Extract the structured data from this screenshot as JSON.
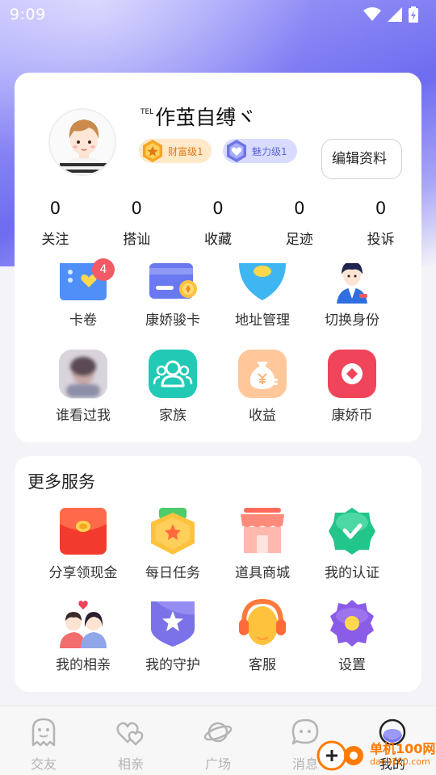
{
  "status_bar": {
    "time": "9:09"
  },
  "profile": {
    "tel_mark": "TEL",
    "nickname": "作茧自缚ヾ",
    "wealth_badge": "财富级1",
    "charm_badge": "魅力级1",
    "edit_button": "编辑资料"
  },
  "stats": [
    {
      "value": "0",
      "label": "关注"
    },
    {
      "value": "0",
      "label": "搭讪"
    },
    {
      "value": "0",
      "label": "收藏"
    },
    {
      "value": "0",
      "label": "足迹"
    },
    {
      "value": "0",
      "label": "投诉"
    }
  ],
  "top_grid": [
    {
      "label": "卡卷",
      "badge": "4",
      "icon": "ticket-icon"
    },
    {
      "label": "康娇骏卡",
      "icon": "vip-card-icon"
    },
    {
      "label": "地址管理",
      "icon": "address-icon"
    },
    {
      "label": "切换身份",
      "icon": "identity-icon"
    },
    {
      "label": "谁看过我",
      "icon": "visitors-icon"
    },
    {
      "label": "家族",
      "icon": "family-icon"
    },
    {
      "label": "收益",
      "icon": "income-bag-icon"
    },
    {
      "label": "康娇币",
      "icon": "coin-icon"
    }
  ],
  "more_services": {
    "title": "更多服务",
    "items": [
      {
        "label": "分享领现金",
        "icon": "red-envelope-icon"
      },
      {
        "label": "每日任务",
        "icon": "daily-task-icon"
      },
      {
        "label": "道具商城",
        "icon": "shop-icon"
      },
      {
        "label": "我的认证",
        "icon": "verified-icon"
      },
      {
        "label": "我的相亲",
        "icon": "couple-icon"
      },
      {
        "label": "我的守护",
        "icon": "guard-shield-icon"
      },
      {
        "label": "客服",
        "icon": "headset-icon"
      },
      {
        "label": "设置",
        "icon": "settings-gear-icon"
      }
    ]
  },
  "tabbar": [
    {
      "label": "交友",
      "icon": "ghost-icon"
    },
    {
      "label": "相亲",
      "icon": "hearts-icon"
    },
    {
      "label": "广场",
      "icon": "planet-icon"
    },
    {
      "label": "消息",
      "icon": "chat-bubble-icon"
    },
    {
      "label": "我的",
      "icon": "profile-face-icon",
      "active": true
    }
  ],
  "watermark": {
    "cn": "单机100网",
    "url": "danji100.com"
  },
  "colors": {
    "accent": "#7b78f2",
    "wealth": "#e07a16",
    "charm": "#5b63d9",
    "red": "#f0445a",
    "teal": "#22c9b5"
  }
}
